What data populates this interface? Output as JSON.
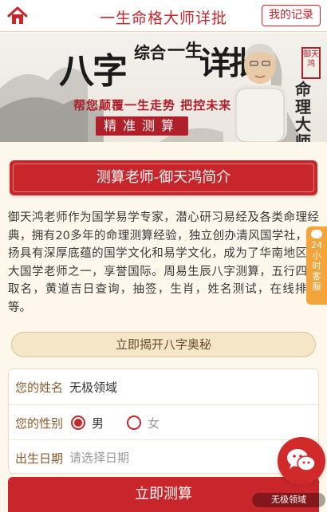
{
  "header": {
    "title": "一生命格大师详批",
    "records_label": "我的记录"
  },
  "banner": {
    "title_big": "八字",
    "title_small": "综合",
    "title_mid": "一生",
    "title_big2": "详批",
    "slogan": "帮您颠覆一生走势 把控未来",
    "tag": "精准测算",
    "seal": "御天鸿",
    "signature": "命理大师"
  },
  "section": {
    "heading": "测算老师-御天鸿简介"
  },
  "intro": {
    "text": "御天鸿老师作为国学易学专家，潜心研习易经及各类命理经典，拥有20多年的命理测算经验，独立创办清风国学社，弘扬具有深厚底蕴的国学文化和易学文化，成为了华南地区十大国学老师之一，享誉国际。周易生辰八字测算，五行四柱取名，黄道吉日查询，抽签，生肖，姓名测试，在线排盘等。"
  },
  "reveal_button": {
    "label": "立即揭开八字奥秘"
  },
  "form": {
    "name_label": "您的姓名",
    "name_value": "无极领域",
    "gender_label": "您的性别",
    "gender_male": "男",
    "gender_female": "女",
    "gender_selected": "男",
    "birth_label": "出生日期",
    "birth_placeholder": "请选择日期"
  },
  "submit": {
    "label": "立即测算"
  },
  "side_tab": {
    "label": "24小时客服"
  },
  "wechat": {
    "label": "老师微信"
  },
  "watermark": {
    "text": "无极领域"
  },
  "colors": {
    "accent": "#c8262a",
    "background": "#fdf7ec",
    "side_tab": "#f3a43a"
  }
}
